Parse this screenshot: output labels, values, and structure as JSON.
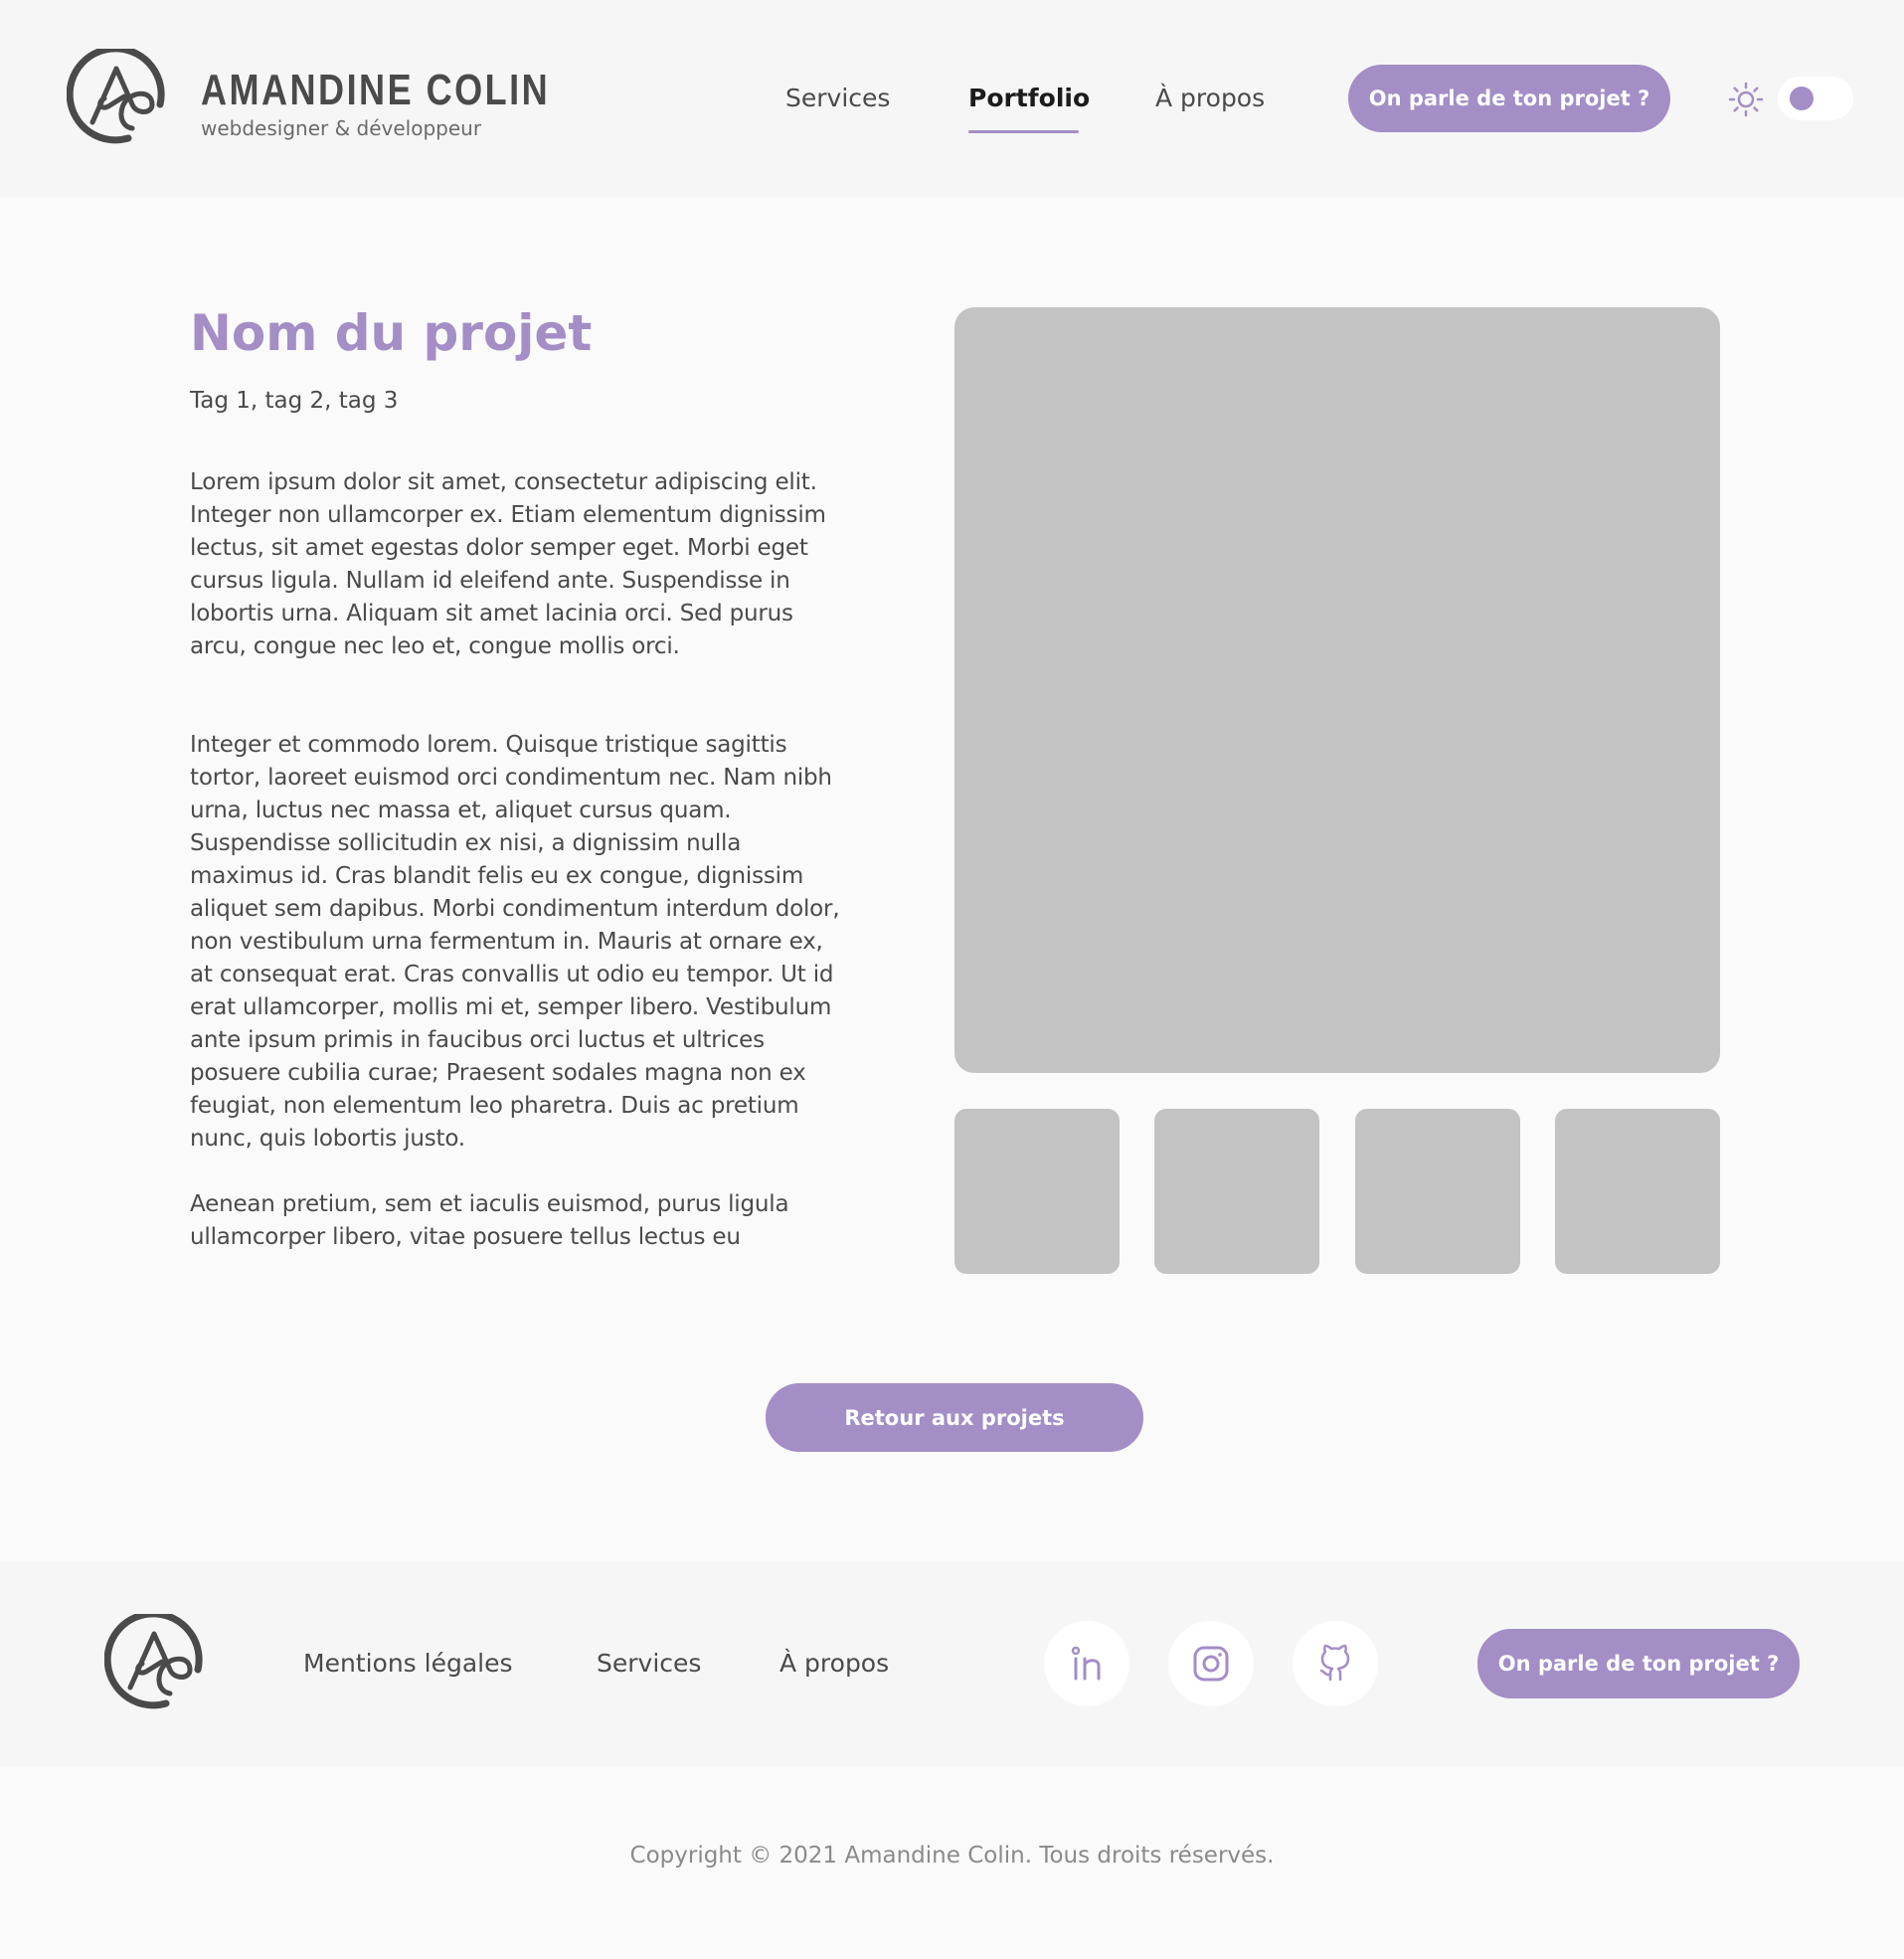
{
  "header": {
    "brand_name": "AMANDINE COLIN",
    "brand_sub": "webdesigner & développeur",
    "nav": {
      "services": "Services",
      "portfolio": "Portfolio",
      "about": "À propos"
    },
    "cta_label": "On parle de ton projet ?",
    "theme_icon": "sun-icon"
  },
  "project": {
    "title": "Nom du projet",
    "tags": "Tag 1, tag 2, tag 3",
    "paragraphs": [
      "Lorem ipsum dolor sit amet, consectetur adipiscing elit. Integer non ullamcorper ex. Etiam elementum dignissim lectus, sit amet egestas dolor semper eget. Morbi eget cursus ligula. Nullam id eleifend ante. Suspendisse in lobortis urna. Aliquam sit amet lacinia orci. Sed purus arcu, congue nec leo et, congue mollis orci.",
      "Integer et commodo lorem. Quisque tristique sagittis tortor, laoreet euismod orci condimentum nec. Nam nibh urna, luctus nec massa et, aliquet cursus quam. Suspendisse sollicitudin ex nisi, a dignissim nulla maximus id. Cras blandit felis eu ex congue, dignissim aliquet sem dapibus. Morbi condimentum interdum dolor, non vestibulum urna fermentum in. Mauris at ornare ex, at consequat erat. Cras convallis ut odio eu tempor. Ut id erat ullamcorper, mollis mi et, semper libero. Vestibulum ante ipsum primis in faucibus orci luctus et ultrices posuere cubilia curae; Praesent sodales magna non ex feugiat, non elementum leo pharetra. Duis ac pretium nunc, quis lobortis justo.",
      "Aenean pretium, sem et iaculis euismod, purus ligula ullamcorper libero, vitae posuere tellus lectus eu"
    ],
    "back_label": "Retour aux projets"
  },
  "footer": {
    "links": {
      "legal": "Mentions légales",
      "services": "Services",
      "about": "À propos"
    },
    "social_icons": [
      "linkedin-icon",
      "instagram-icon",
      "github-icon"
    ],
    "cta_label": "On parle de ton projet ?",
    "copyright": "Copyright © 2021 Amandine Colin. Tous droits réservés."
  },
  "colors": {
    "accent": "#a38ec6",
    "text": "#4a4a4a",
    "placeholder": "#c3c3c3",
    "band": "#f6f6f6",
    "background": "#fafafa"
  }
}
